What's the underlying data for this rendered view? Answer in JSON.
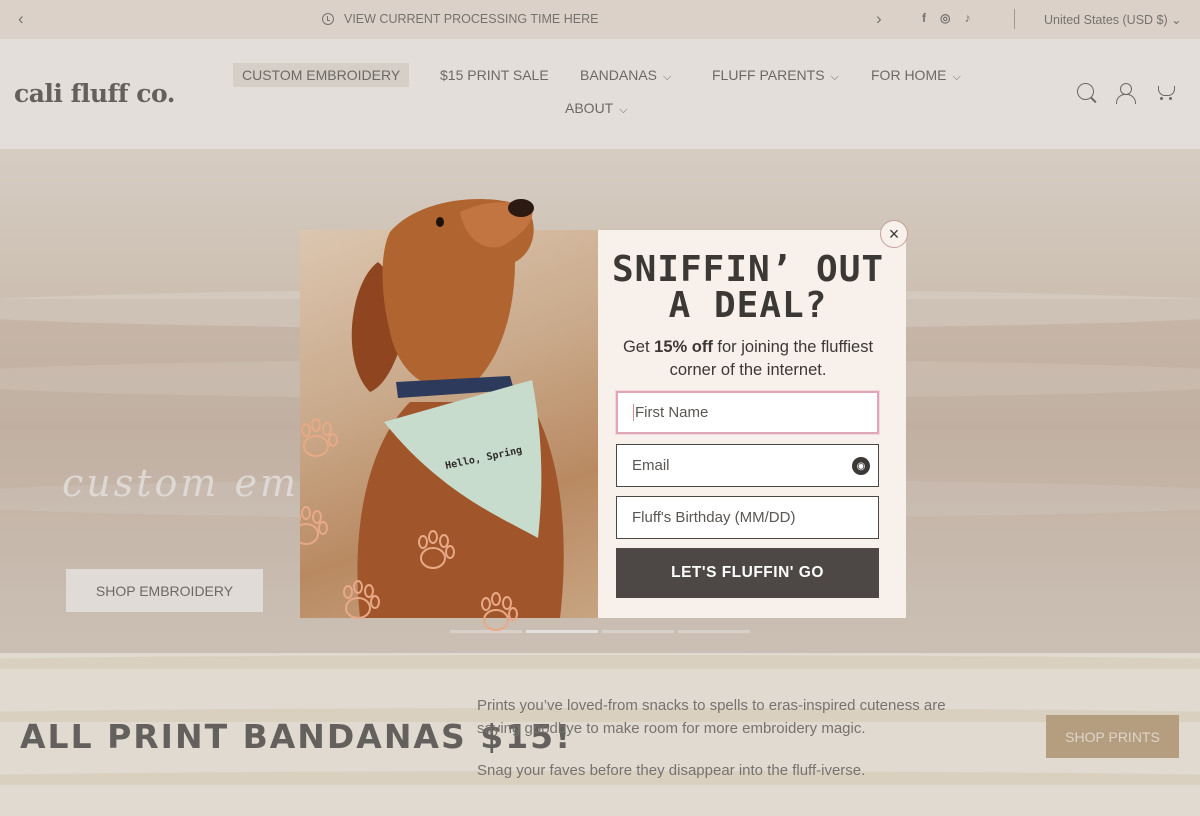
{
  "announcement": {
    "message": "VIEW CURRENT PROCESSING TIME HERE",
    "prev_icon": "chevron-left-icon",
    "next_icon": "chevron-right-icon",
    "social": [
      "f",
      "◎",
      "♪"
    ],
    "country": "United States (USD $)"
  },
  "header": {
    "logo": "cali fluff co.",
    "nav": [
      {
        "label": "CUSTOM EMBROIDERY",
        "dropdown": false
      },
      {
        "label": "$15 PRINT SALE",
        "dropdown": false
      },
      {
        "label": "BANDANAS",
        "dropdown": true
      },
      {
        "label": "FLUFF PARENTS",
        "dropdown": true
      },
      {
        "label": "FOR HOME",
        "dropdown": true
      },
      {
        "label": "ABOUT",
        "dropdown": true
      }
    ],
    "icons": [
      "search-icon",
      "account-icon",
      "cart-icon"
    ]
  },
  "hero": {
    "script_text": "custom em",
    "button": "SHOP EMBROIDERY"
  },
  "band": {
    "headline": "ALL PRINT BANDANAS $15!",
    "copy1": "Prints you’ve loved-from snacks to spells to eras-inspired cuteness are saying goodbye to make room for more embroidery magic.",
    "copy2": "Snag your faves before they disappear into the fluff-iverse.",
    "button": "SHOP PRINTS"
  },
  "popup": {
    "title_line1": "SNIFFIN’ OUT",
    "title_line2": "A DEAL?",
    "sub_pre": "Get ",
    "sub_bold": "15% off",
    "sub_post": " for joining the fluffiest corner of the internet.",
    "bandana_text": "Hello, Spring",
    "first_name_placeholder": "First Name",
    "email_placeholder": "Email",
    "birthday_placeholder": "Fluff's Birthday (MM/DD)",
    "submit": "LET'S FLUFFIN' GO",
    "close": "×"
  },
  "colors": {
    "accent": "#b08e60",
    "button_dark": "#4d4845",
    "popup_bg": "#f8f0ea",
    "focus_border": "#e0a7b6"
  }
}
